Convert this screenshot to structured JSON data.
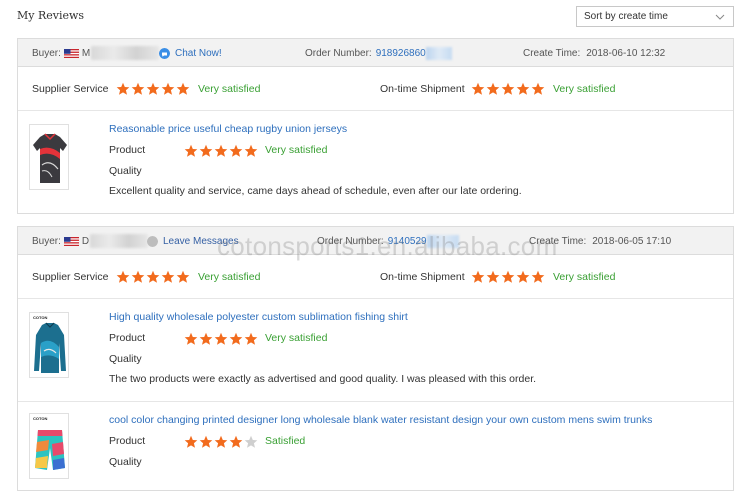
{
  "page": {
    "title": "My Reviews"
  },
  "sort": {
    "label": "Sort by create time"
  },
  "labels": {
    "buyer": "Buyer:",
    "order_number": "Order Number:",
    "create_time": "Create Time:",
    "supplier_service": "Supplier Service",
    "ontime_shipment": "On-time Shipment",
    "product": "Product",
    "quality": "Quality"
  },
  "reviews": [
    {
      "buyer_initial": "M",
      "buyer_flag": "us-flag",
      "action_label": "Chat Now!",
      "order_number": "918926860",
      "create_time": "2018-06-10 12:32",
      "supplier_rating": 5,
      "supplier_text": "Very satisfied",
      "shipment_rating": 5,
      "shipment_text": "Very satisfied",
      "products": [
        {
          "title": "Reasonable price useful cheap rugby union jerseys",
          "rating": 5,
          "rating_text": "Very satisfied",
          "comment": "Excellent quality and service, came days ahead of schedule, even after our late ordering."
        }
      ]
    },
    {
      "buyer_initial": "D",
      "buyer_flag": "us-flag",
      "action_label": "Leave Messages",
      "order_number": "9140529",
      "create_time": "2018-06-05 17:10",
      "supplier_rating": 5,
      "supplier_text": "Very satisfied",
      "shipment_rating": 5,
      "shipment_text": "Very satisfied",
      "products": [
        {
          "title": "High quality wholesale polyester custom sublimation fishing shirt",
          "rating": 5,
          "rating_text": "Very satisfied",
          "comment": "The two products were exactly as advertised and good quality. I was pleased with this order.",
          "thumb_brand": "COTON"
        },
        {
          "title": "cool color changing printed designer long wholesale blank water resistant design your own custom mens swim trunks",
          "rating": 4,
          "rating_text": "Satisfied",
          "thumb_brand": "COTON"
        }
      ]
    }
  ],
  "watermark": "cotonsports1.en.alibaba.com",
  "colors": {
    "star": "#f26b1d",
    "star_empty": "#cfcfcf",
    "link": "#2e6fbd",
    "satisfied": "#3aa034"
  }
}
